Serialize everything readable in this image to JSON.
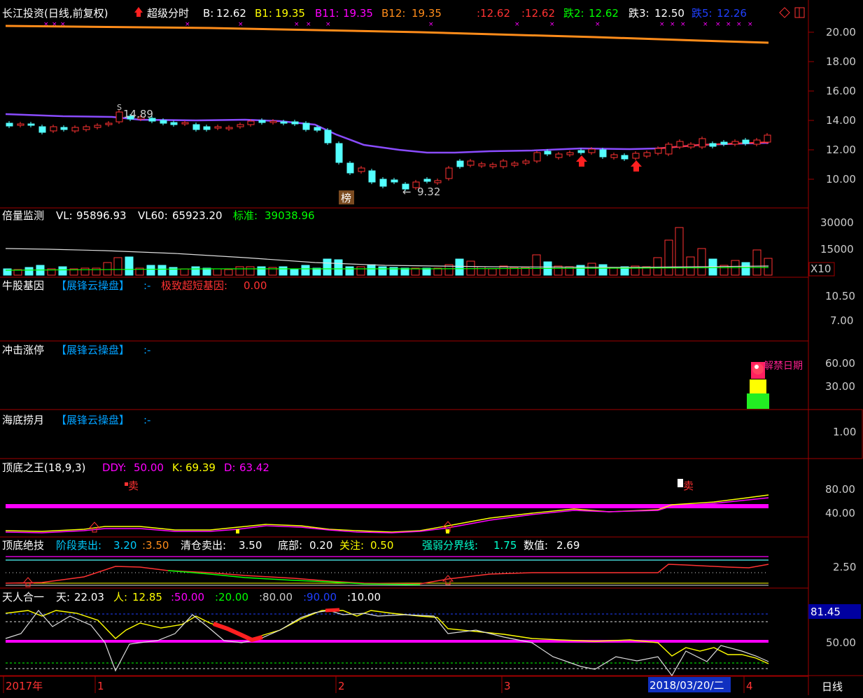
{
  "header": {
    "stock_title": "长江投资(日线,前复权)",
    "super_label": "超级分时",
    "b_label": "B:",
    "b_value": "12.62",
    "b1_label": "B1:",
    "b1_value": "19.35",
    "b11_label": "B11:",
    "b11_value": "19.35",
    "b12_label": "B12:",
    "b12_value": "19.35",
    "p1": ":12.62",
    "p2": ":12.62",
    "d2_label": "跌2:",
    "d2_value": "12.62",
    "d3_label": "跌3:",
    "d3_value": "12.50",
    "d5_label": "跌5:",
    "d5_value": "12.26"
  },
  "main_chart": {
    "y_ticks": [
      "20.00",
      "18.00",
      "16.00",
      "14.00",
      "12.00",
      "10.00"
    ],
    "high_label": "14.89",
    "low_label": "9.32",
    "bang_label": "榜"
  },
  "volume_panel": {
    "title": "倍量监测",
    "vl_label": "VL:",
    "vl_value": "95896.93",
    "vl60_label": "VL60:",
    "vl60_value": "65923.20",
    "std_label": "标准:",
    "std_value": "39038.96",
    "y_ticks": [
      "30000",
      "15000"
    ],
    "scale_label": "X10"
  },
  "niugu_panel": {
    "title": "牛股基因",
    "brand": "【展锋云操盘】",
    "suffix": ":-",
    "signal_label": "极致超短基因:",
    "signal_value": "0.00",
    "y_ticks": [
      "10.50",
      "7.00"
    ]
  },
  "chongji_panel": {
    "title": "冲击涨停",
    "brand": "【展锋云操盘】",
    "suffix": ":-",
    "badge_label": "解禁日期",
    "y_ticks": [
      "60.00",
      "30.00"
    ]
  },
  "haidi_panel": {
    "title": "海底捞月",
    "brand": "【展锋云操盘】",
    "suffix": ":-",
    "y_ticks": [
      "1.00"
    ]
  },
  "dingdi_panel": {
    "title": "顶底之王(18,9,3)",
    "ddy_label": "DDY:",
    "ddy_value": "50.00",
    "k_label": "K:",
    "k_value": "69.39",
    "d_label": "D:",
    "d_value": "63.42",
    "sell_label": "卖",
    "y_ticks": [
      "80.00",
      "40.00"
    ]
  },
  "juji_panel": {
    "title": "顶底绝技",
    "stage_label": "阶段卖出:",
    "stage_v1": "3.20",
    "stage_v2": ":3.50",
    "clear_label": "清仓卖出:",
    "clear_value": "3.50",
    "bottom_label": "底部:",
    "bottom_value": "0.20",
    "focus_label": "关注:",
    "focus_value": "0.50",
    "strong_label": "强弱分界线:",
    "strong_value": "1.75",
    "num_label": "数值:",
    "num_value": "2.69",
    "y_ticks": [
      "2.50"
    ]
  },
  "tianren_panel": {
    "title": "天人合一",
    "tian_label": "天:",
    "tian_value": "22.03",
    "ren_label": "人:",
    "ren_value": "12.85",
    "v1": ":50.00",
    "v2": ":20.00",
    "v3": ":80.00",
    "v4": ":90.00",
    "v5": ":10.00",
    "y_ticks": [
      "50.00"
    ],
    "current_badge": "81.45"
  },
  "time_axis": {
    "labels": [
      "2017年",
      "1",
      "2",
      "3",
      "4"
    ],
    "date_badge": "2018/03/20/二",
    "period_button": "日线"
  },
  "colors": {
    "up": "#ff3232",
    "down": "#54ffff",
    "ma": "#8a4cff",
    "orange": "#ff8c1a",
    "magenta": "#ff00ff",
    "yellow": "#ffff00",
    "green": "#00ff00",
    "white": "#ffffff",
    "border": "#a00000"
  }
}
